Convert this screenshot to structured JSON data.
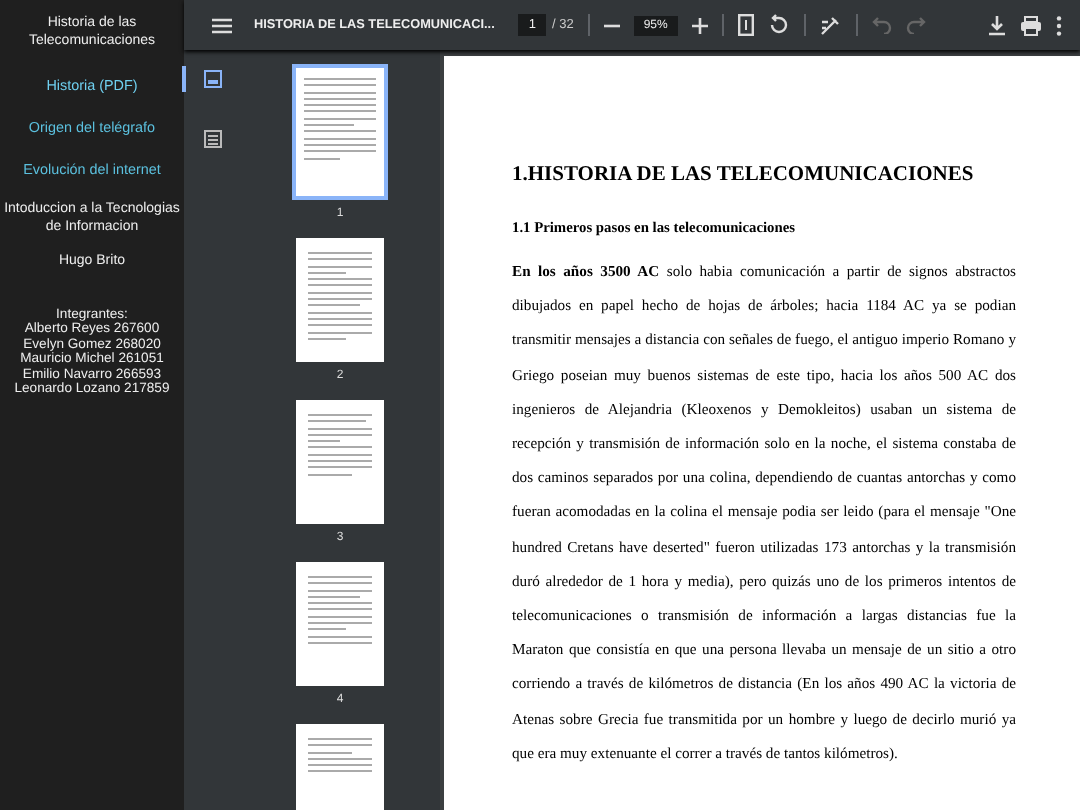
{
  "nav": {
    "title": "Historia de las Telecomunicaciones",
    "links": [
      {
        "label": "Historia (PDF)",
        "selected": true
      },
      {
        "label": "Origen del telégrafo",
        "selected": false
      },
      {
        "label": "Evolución del internet",
        "selected": false
      }
    ],
    "course": "Intoduccion a la Tecnologias de Informacion",
    "teacher": "Hugo Brito",
    "members_heading": "Integrantes:",
    "members": [
      "Alberto Reyes 267600",
      "Evelyn Gomez 268020",
      "Mauricio Michel 261051",
      "Emilio Navarro 266593",
      "Leonardo Lozano 217859"
    ]
  },
  "toolbar": {
    "title": "HISTORIA DE LAS TELECOMUNICACI...",
    "page": "1",
    "page_count": "/ 32",
    "zoom": "95%",
    "undo_disabled": true
  },
  "side_tabs": [
    {
      "kind": "thumbnails",
      "selected": true
    },
    {
      "kind": "outline",
      "selected": false
    }
  ],
  "thumbnails": [
    {
      "label": "1",
      "selected": true
    },
    {
      "label": "2",
      "selected": false
    },
    {
      "label": "3",
      "selected": false
    },
    {
      "label": "4",
      "selected": false
    },
    {
      "selected": false
    }
  ],
  "page": {
    "heading": "1.HISTORIA DE LAS TELECOMUNICACIONES",
    "subheading": "1.1 Primeros pasos en las telecomunicaciones",
    "paragraph": "**En los años 3500 AC** solo habia comunicación a partir de signos abstractos dibujados en papel hecho de hojas de árboles; hacia 1184 AC ya se podian transmitir mensajes a distancia con señales de fuego, el antiguo imperio Romano y Griego poseian muy buenos sistemas de este tipo, hacia los años 500 AC dos ingenieros de Alejandria (Kleoxenos y Demokleitos) usaban un sistema de recepción y transmisión de información solo en la noche, el sistema constaba de dos caminos separados por una colina, dependiendo de cuantas antorchas y como fueran acomodadas en la colina el mensaje podia ser leido (para el mensaje \"One hundred Cretans have deserted\" fueron utilizadas 173 antorchas y la transmisión duró alrededor de 1 hora y media), pero quizás uno de los primeros intentos de telecomunicaciones o transmisión de información a largas distancias fue la Maraton que consistía en que una persona llevaba un mensaje de un sitio a otro corriendo a través de kilómetros de distancia (En los años 490 AC la victoria de Atenas sobre Grecia fue transmitida por un hombre y luego de decirlo murió ya que era muy extenuante el correr a través de tantos kilómetros)."
  }
}
